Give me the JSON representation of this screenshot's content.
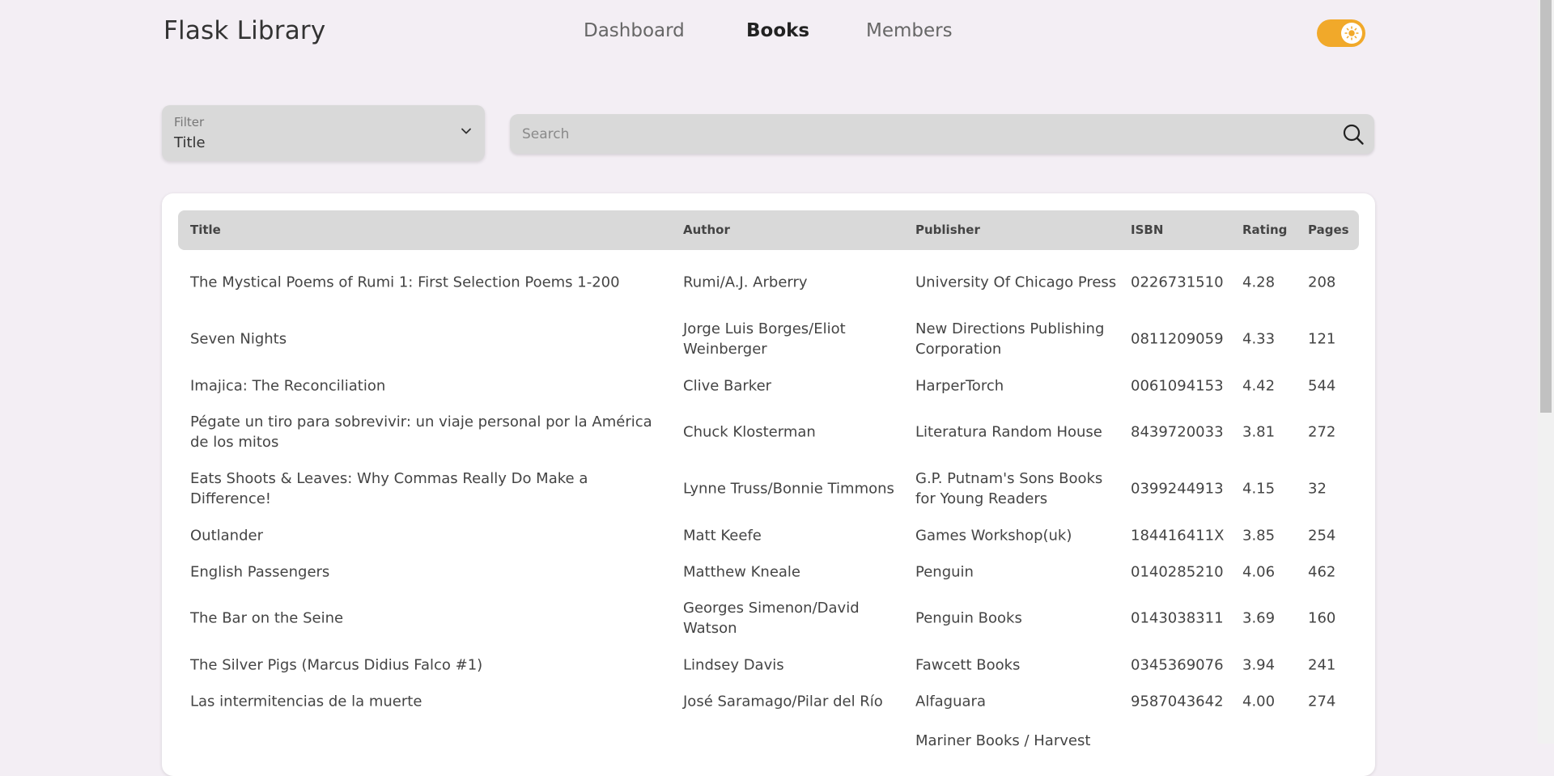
{
  "app": {
    "title": "Flask Library"
  },
  "nav": {
    "dashboard": "Dashboard",
    "books": "Books",
    "members": "Members"
  },
  "theme_toggle": {
    "icon": "sun-icon",
    "accent": "#f1a92a"
  },
  "filter": {
    "label": "Filter",
    "value": "Title"
  },
  "search": {
    "placeholder": "Search",
    "value": ""
  },
  "table": {
    "headers": {
      "title": "Title",
      "author": "Author",
      "publisher": "Publisher",
      "isbn": "ISBN",
      "rating": "Rating",
      "pages": "Pages"
    },
    "rows": [
      {
        "title": "The Mystical Poems of Rumi 1: First Selection Poems 1-200",
        "author": "Rumi/A.J. Arberry",
        "publisher": "University Of Chicago Press",
        "isbn": "0226731510",
        "rating": "4.28",
        "pages": "208"
      },
      {
        "title": "Seven Nights",
        "author": "Jorge Luis Borges/Eliot Weinberger",
        "publisher": "New Directions Publishing Corporation",
        "isbn": "0811209059",
        "rating": "4.33",
        "pages": "121"
      },
      {
        "title": "Imajica: The Reconciliation",
        "author": "Clive Barker",
        "publisher": "HarperTorch",
        "isbn": "0061094153",
        "rating": "4.42",
        "pages": "544"
      },
      {
        "title": "Pégate un tiro para sobrevivir: un viaje personal por la América de los mitos",
        "author": "Chuck Klosterman",
        "publisher": "Literatura Random House",
        "isbn": "8439720033",
        "rating": "3.81",
        "pages": "272"
      },
      {
        "title": "Eats Shoots & Leaves: Why Commas Really Do Make a Difference!",
        "author": "Lynne Truss/Bonnie Timmons",
        "publisher": "G.P. Putnam's Sons Books for Young Readers",
        "isbn": "0399244913",
        "rating": "4.15",
        "pages": "32"
      },
      {
        "title": "Outlander",
        "author": "Matt Keefe",
        "publisher": "Games Workshop(uk)",
        "isbn": "184416411X",
        "rating": "3.85",
        "pages": "254"
      },
      {
        "title": "English Passengers",
        "author": "Matthew Kneale",
        "publisher": "Penguin",
        "isbn": "0140285210",
        "rating": "4.06",
        "pages": "462"
      },
      {
        "title": "The Bar on the Seine",
        "author": "Georges Simenon/David Watson",
        "publisher": "Penguin Books",
        "isbn": "0143038311",
        "rating": "3.69",
        "pages": "160"
      },
      {
        "title": "The Silver Pigs (Marcus Didius Falco #1)",
        "author": "Lindsey Davis",
        "publisher": "Fawcett Books",
        "isbn": "0345369076",
        "rating": "3.94",
        "pages": "241"
      },
      {
        "title": "Las intermitencias de la muerte",
        "author": "José Saramago/Pilar del Río",
        "publisher": "Alfaguara",
        "isbn": "9587043642",
        "rating": "4.00",
        "pages": "274"
      },
      {
        "title": "",
        "author": "",
        "publisher": "Mariner Books / Harvest",
        "isbn": "",
        "rating": "",
        "pages": ""
      }
    ]
  }
}
